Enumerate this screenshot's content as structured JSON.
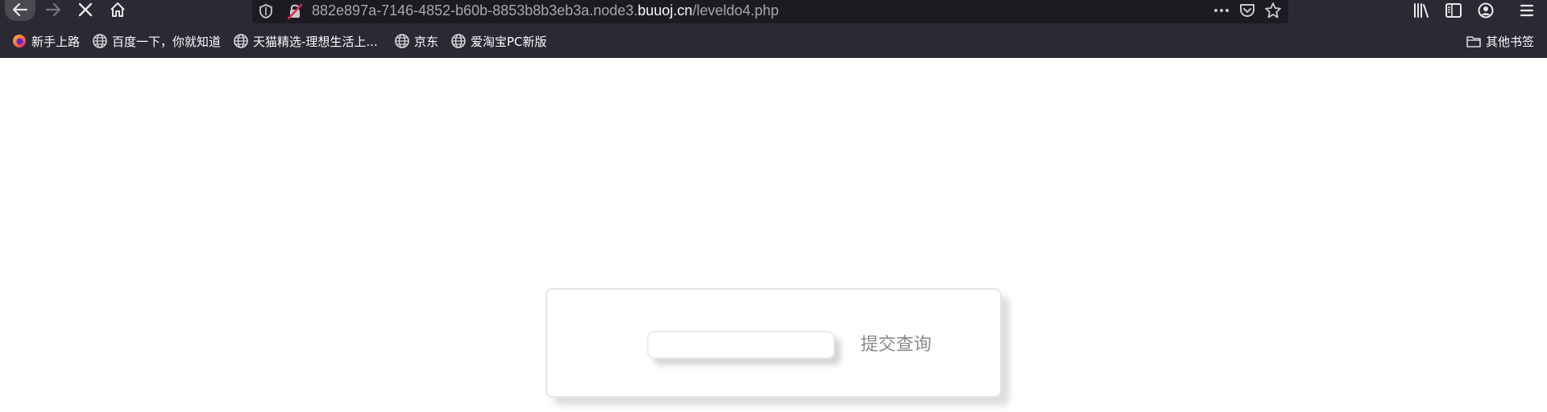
{
  "browser": {
    "url": {
      "prefix": "882e897a-7146-4852-b60b-8853b8b3eb3a.node3.",
      "domain": "buuoj.cn",
      "path": "/leveldo4.php"
    },
    "toolbar_icons": [
      "back-icon",
      "forward-icon",
      "stop-icon",
      "home-icon"
    ],
    "urlbar_icons": [
      "shield-icon",
      "insecure-lock-icon",
      "more-icon",
      "pocket-icon",
      "star-icon"
    ],
    "right_icons": [
      "library-icon",
      "sidebar-icon",
      "account-icon",
      "menu-icon"
    ]
  },
  "bookmarks": {
    "items": [
      {
        "label": "新手上路",
        "icon": "firefox-icon"
      },
      {
        "label": "百度一下，你就知道",
        "icon": "globe-icon"
      },
      {
        "label": "天猫精选-理想生活上...",
        "icon": "globe-icon"
      },
      {
        "label": "京东",
        "icon": "globe-icon"
      },
      {
        "label": "爱淘宝PC新版",
        "icon": "globe-icon"
      }
    ],
    "other": {
      "label": "其他书签",
      "icon": "folder-icon"
    }
  },
  "form": {
    "input_value": "",
    "submit_label": "提交查询"
  },
  "colors": {
    "chrome_bg": "#2b2a33",
    "urlbar_bg": "#1c1b22",
    "page_bg": "#ffffff"
  }
}
